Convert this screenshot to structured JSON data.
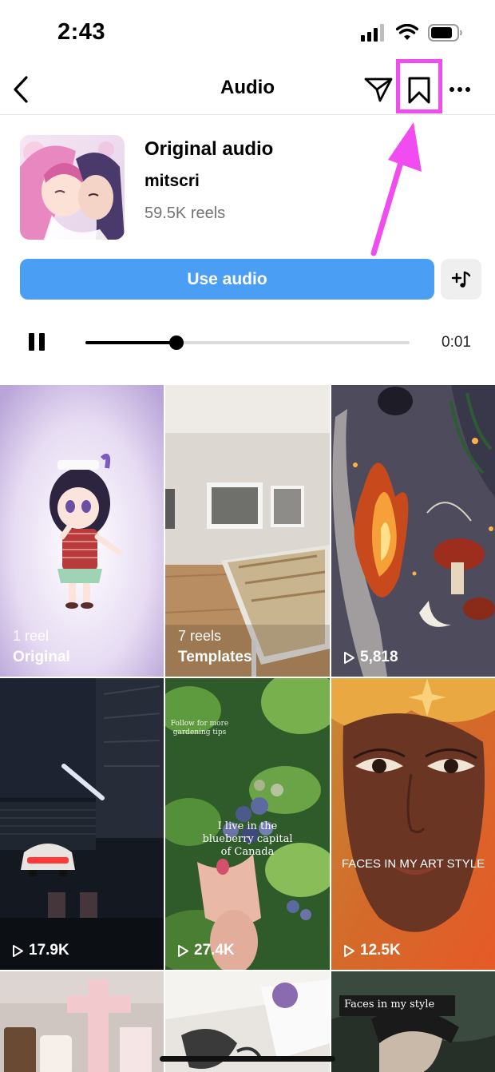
{
  "status_bar": {
    "time": "2:43"
  },
  "nav": {
    "title": "Audio"
  },
  "audio": {
    "title": "Original audio",
    "artist": "mitscri",
    "reel_count": "59.5K reels",
    "use_audio_label": "Use audio"
  },
  "player": {
    "elapsed": "0:01",
    "progress": 0.28
  },
  "grid": [
    {
      "count": "1 reel",
      "label": "Original"
    },
    {
      "count": "7 reels",
      "label": "Templates"
    },
    {
      "plays": "5,818"
    },
    {
      "plays": "17.9K"
    },
    {
      "plays": "27.4K",
      "overlay": "I live in the blueberry capital of Canada",
      "overlay_small": "Follow for more gardening tips"
    },
    {
      "plays": "12.5K",
      "overlay": "FACES IN MY ART STYLE"
    },
    {
      "plays": ""
    },
    {
      "plays": ""
    },
    {
      "plays": "",
      "overlay": "Faces in my style"
    }
  ],
  "colors": {
    "accent": "#4a9ff5",
    "highlight": "#f04cf0"
  }
}
